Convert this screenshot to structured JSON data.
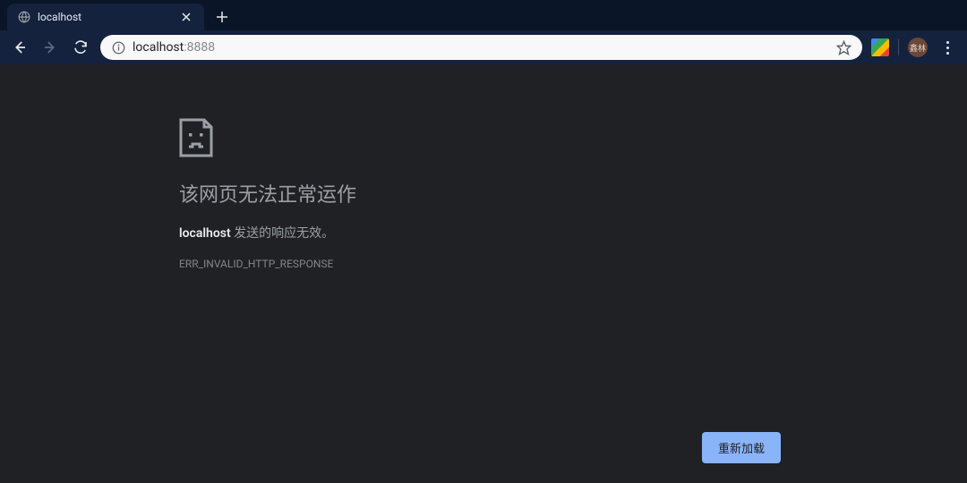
{
  "tab": {
    "title": "localhost"
  },
  "url": {
    "host": "localhost",
    "port": ":8888"
  },
  "avatar": {
    "text": "鑫林"
  },
  "error": {
    "title": "该网页无法正常运作",
    "host": "localhost",
    "desc_rest": " 发送的响应无效。",
    "code": "ERR_INVALID_HTTP_RESPONSE",
    "reload": "重新加载"
  }
}
